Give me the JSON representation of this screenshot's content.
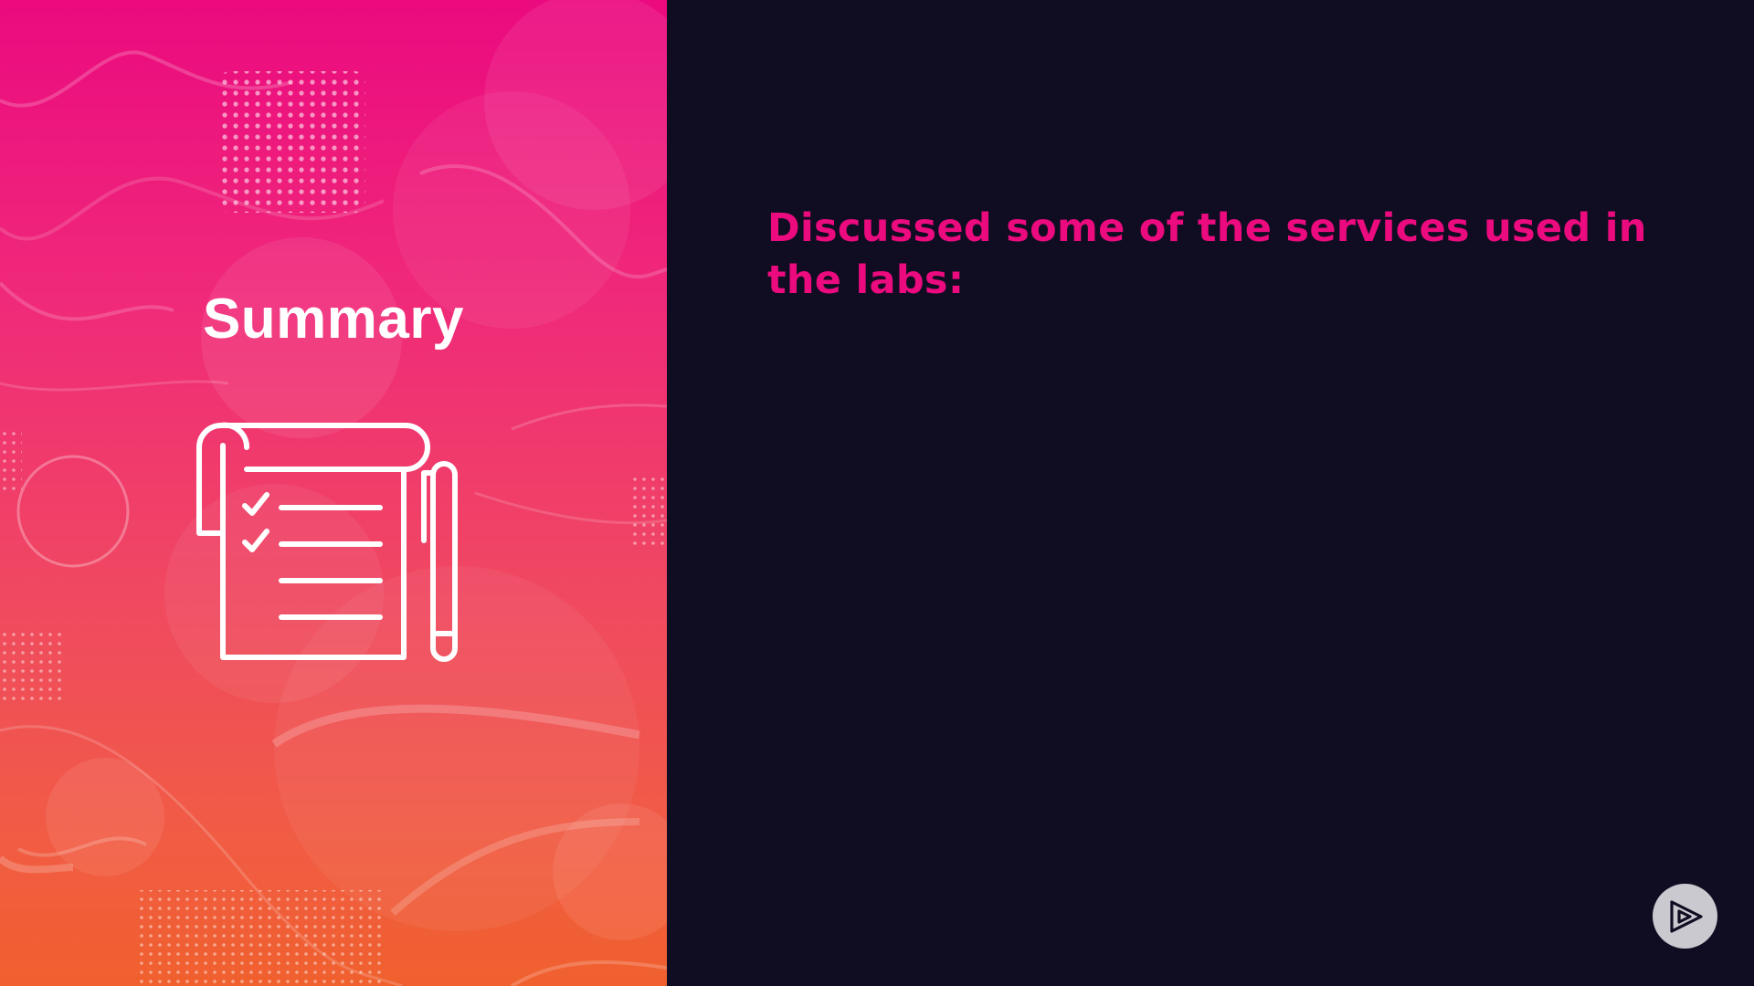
{
  "sidebar": {
    "title": "Summary",
    "illustration_icon": "checklist-notepad-with-pen-icon"
  },
  "content": {
    "heading": "Discussed some of the services used in the labs:"
  },
  "player": {
    "logo_icon": "pluralsight-play-icon"
  },
  "colors": {
    "background": "#100d22",
    "accent": "#ec0a7f",
    "gradient_top": "#eb0a7f",
    "gradient_bottom": "#f0602e",
    "title_text": "#ffffff",
    "play_button": "#c9c9cf"
  }
}
